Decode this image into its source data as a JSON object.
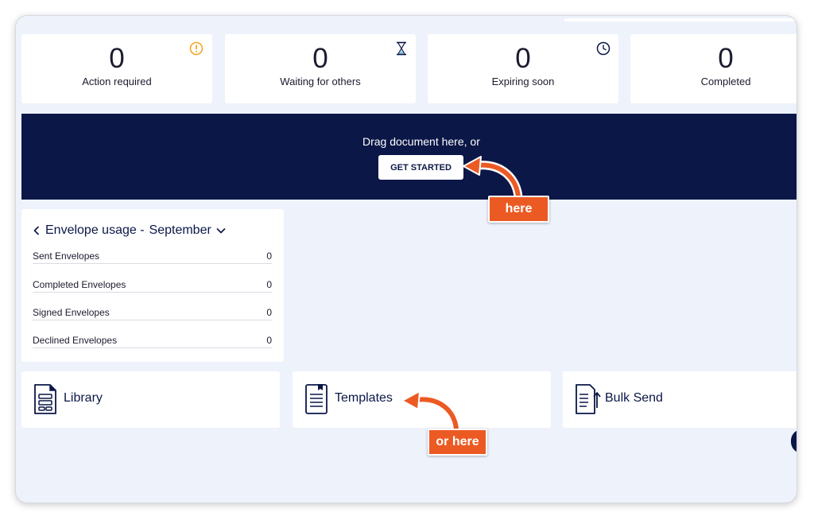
{
  "stats": [
    {
      "value": "0",
      "label": "Action required",
      "icon": "warning-circle-icon",
      "color": "#f5a623"
    },
    {
      "value": "0",
      "label": "Waiting for others",
      "icon": "hourglass-icon",
      "color": "#0b1747"
    },
    {
      "value": "0",
      "label": "Expiring soon",
      "icon": "clock-icon",
      "color": "#0b1747"
    },
    {
      "value": "0",
      "label": "Completed"
    }
  ],
  "banner": {
    "text": "Drag document here, or",
    "button": "GET STARTED",
    "background": "#0b1747"
  },
  "usage": {
    "title": "Envelope usage -",
    "month": "September",
    "rows": [
      {
        "label": "Sent Envelopes",
        "value": "0"
      },
      {
        "label": "Completed Envelopes",
        "value": "0"
      },
      {
        "label": "Signed Envelopes",
        "value": "0"
      },
      {
        "label": "Declined Envelopes",
        "value": "0"
      }
    ]
  },
  "tiles": [
    {
      "label": "Library",
      "icon": "library-icon"
    },
    {
      "label": "Templates",
      "icon": "templates-icon"
    },
    {
      "label": "Bulk Send",
      "icon": "bulk-send-icon"
    }
  ],
  "callouts": {
    "here": "here",
    "or_here": "or here",
    "color": "#ec5a24"
  }
}
